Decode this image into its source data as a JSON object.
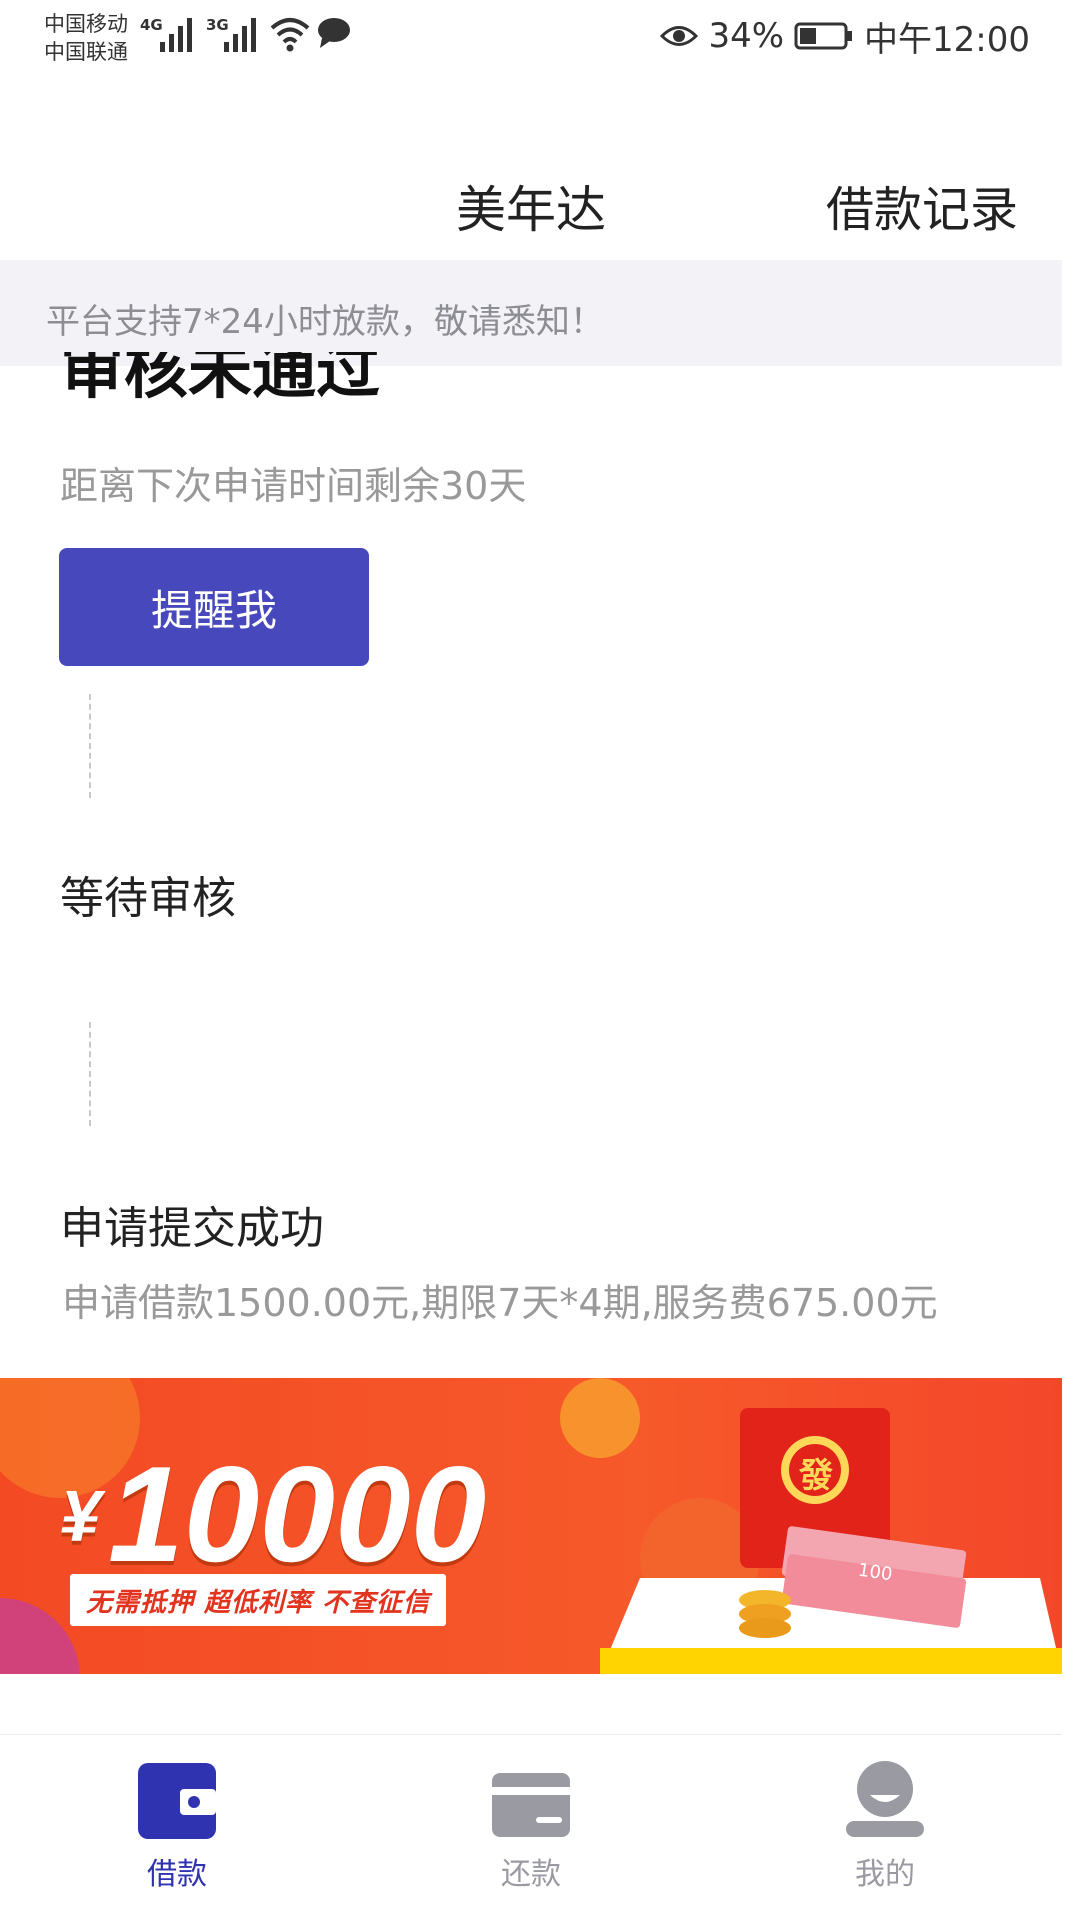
{
  "status_bar": {
    "carrier_1": "中国移动",
    "carrier_2": "中国联通",
    "net_1": "4G",
    "net_2": "3G",
    "battery_percent": "34%",
    "time": "中午12:00"
  },
  "header": {
    "title": "美年达",
    "history_link": "借款记录"
  },
  "notice": {
    "text": "平台支持7*24小时放款，敬请悉知！"
  },
  "status": {
    "title": "审核未通过",
    "subtitle": "距离下次申请时间剩余30天",
    "remind_button": "提醒我"
  },
  "steps": [
    {
      "title": "等待审核"
    },
    {
      "title": "申请提交成功",
      "desc": "申请借款1500.00元,期限7天*4期,服务费675.00元"
    }
  ],
  "banner": {
    "currency": "¥",
    "amount": "10000",
    "tagline": "无需抵押 超低利率 不查征信",
    "envelope_char": "發",
    "bill_label": "100"
  },
  "bottom_nav": {
    "items": [
      {
        "label": "借款",
        "icon": "wallet-icon",
        "active": true
      },
      {
        "label": "还款",
        "icon": "card-icon",
        "active": false
      },
      {
        "label": "我的",
        "icon": "user-icon",
        "active": false
      }
    ]
  },
  "colors": {
    "primary": "#4748bc",
    "nav_active": "#2f33b0",
    "nav_inactive": "#9a9aa3",
    "banner_orange": "#f25a22",
    "muted_text": "#999999"
  }
}
